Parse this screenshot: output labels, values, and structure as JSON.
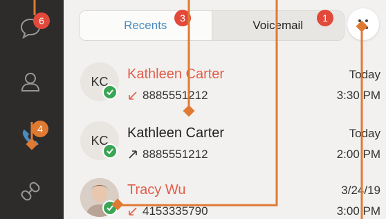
{
  "colors": {
    "sidebar": "#2d2c2b",
    "accent_blue": "#4a8bc0",
    "missed_red": "#e25d4a",
    "badge_red": "#e2493b",
    "annotation_orange": "#e07a32",
    "presence_green": "#3aa655"
  },
  "sidebar": {
    "items": [
      {
        "name": "chat",
        "icon": "chat-bubble-icon",
        "badge": "6"
      },
      {
        "name": "contacts",
        "icon": "person-icon"
      },
      {
        "name": "calls",
        "icon": "phone-icon",
        "badge": "4",
        "active": true
      },
      {
        "name": "links",
        "icon": "link-icon"
      }
    ]
  },
  "tabs": {
    "recents_label": "Recents",
    "recents_badge": "3",
    "voicemail_label": "Voicemail",
    "voicemail_badge": "1"
  },
  "more_button": {
    "icon": "grid-dots-icon"
  },
  "calls": [
    {
      "initials": "KC",
      "name": "Kathleen Carter",
      "missed": true,
      "direction": "incoming",
      "number": "8885551212",
      "date": "Today",
      "time": "3:30 PM"
    },
    {
      "initials": "KC",
      "name": "Kathleen Carter",
      "missed": false,
      "direction": "outgoing",
      "number": "8885551212",
      "date": "Today",
      "time": "2:00 PM"
    },
    {
      "initials": "",
      "name": "Tracy Wu",
      "missed": true,
      "direction": "incoming",
      "number": "4153335790",
      "date": "3/24/19",
      "time": "3:00 PM"
    }
  ]
}
